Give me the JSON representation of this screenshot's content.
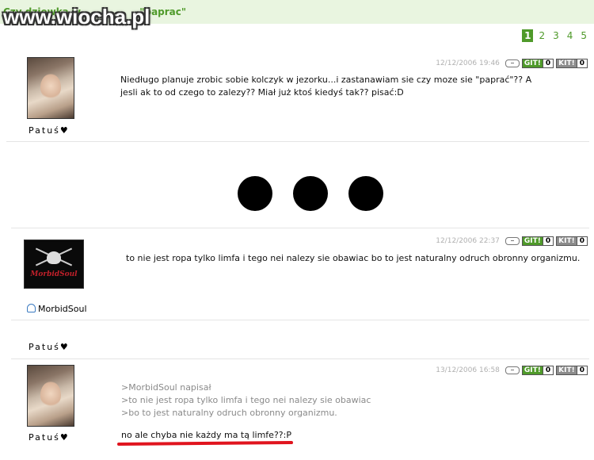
{
  "thread": {
    "title": "Czy dziewka w ",
    "title_end": "\"paprac\""
  },
  "watermark": "www.wiocha.pl",
  "pager": [
    "1",
    "2",
    "3",
    "4",
    "5"
  ],
  "posts": [
    {
      "author": "Patuś♥",
      "date": "12/12/2006 19:46",
      "git_label": "GIT!",
      "git_count": "0",
      "kit_label": "KIT!",
      "kit_count": "0",
      "text": "Niedługo planuje zrobic sobie kolczyk w jezorku...i zastanawiam sie czy moze sie \"paprać\"?? A jesli ak to od czego to zalezy?? Miał już ktoś kiedyś tak?? pisać:D"
    },
    {
      "author": "MorbidSoul",
      "avatar_text": "MorbidSoul",
      "date": "12/12/2006 22:37",
      "git_label": "GIT!",
      "git_count": "0",
      "kit_label": "KIT!",
      "kit_count": "0",
      "text": "to nie jest ropa tylko limfa i tego nei nalezy sie obawiac bo to jest naturalny odruch obronny organizmu."
    },
    {
      "author": "Patuś♥",
      "date": "13/12/2006 16:58",
      "git_label": "GIT!",
      "git_count": "0",
      "kit_label": "KIT!",
      "kit_count": "0",
      "quote": [
        ">MorbidSoul napisał",
        ">to nie jest ropa tylko limfa i tego nei nalezy sie obawiac",
        ">bo to jest naturalny odruch obronny organizmu."
      ],
      "text": "no ale chyba nie każdy ma tą limfe??:P"
    }
  ],
  "stray_author": "Patuś♥",
  "colors": {
    "accent": "#4f9a2a",
    "highlight": "#e0141e",
    "kit": "#8c8c8c"
  }
}
